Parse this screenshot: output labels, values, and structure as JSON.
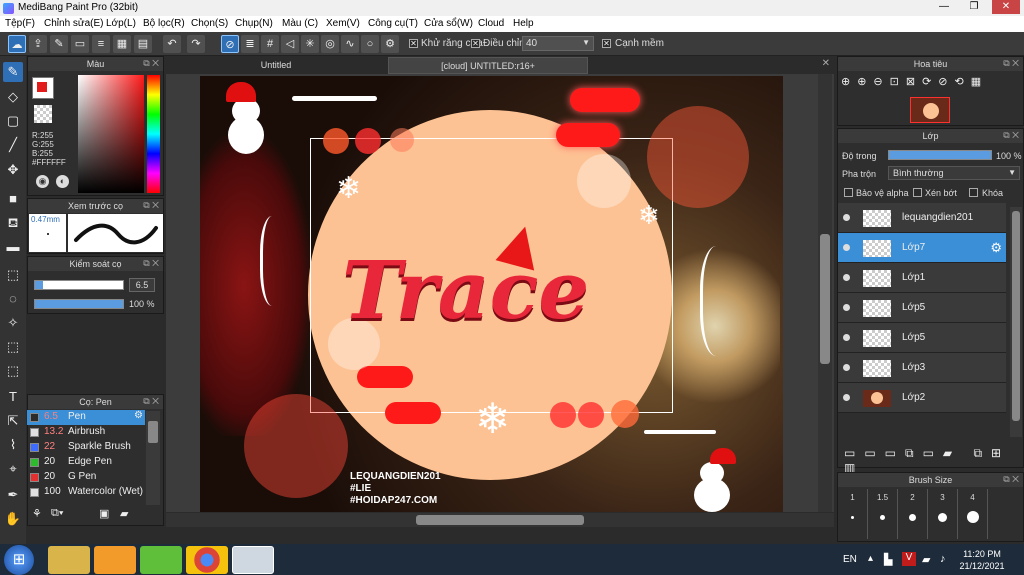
{
  "window": {
    "title": "MediBang Paint Pro (32bit)",
    "min": "—",
    "max": "❐",
    "close": "✕"
  },
  "menu": [
    "Tệp(F)",
    "Chỉnh sửa(E)",
    "Lớp(L)",
    "Bộ lọc(R)",
    "Chọn(S)",
    "Chụp(N)",
    "Màu (C)",
    "Xem(V)",
    "Công cụ(T)",
    "Cửa sổ(W)",
    "Cloud",
    "Help"
  ],
  "toolbar": {
    "antialias_label": "Khử răng cưa",
    "adjust_label": "Điều chỉnh",
    "adjust_value": "40",
    "sharpen_label": "Cạnh mềm"
  },
  "color_panel": {
    "title": "Màu",
    "r": "R:255",
    "g": "G:255",
    "b": "B:255",
    "hex": "#FFFFFF"
  },
  "preview_panel": {
    "title": "Xem trước cọ",
    "size": "0.47mm"
  },
  "control_panel": {
    "title": "Kiểm soát cọ",
    "size": "6.5",
    "opacity": "100 %"
  },
  "brush_panel": {
    "title": "Cọ: Pen",
    "items": [
      {
        "size": "6.5",
        "name": "Pen",
        "color": "#2b2b2b"
      },
      {
        "size": "13.2",
        "name": "Airbrush",
        "color": "#e0e0e0"
      },
      {
        "size": "22",
        "name": "Sparkle Brush",
        "color": "#3d6cff"
      },
      {
        "size": "20",
        "name": "Edge Pen",
        "color": "#2dba2d"
      },
      {
        "size": "20",
        "name": "G Pen",
        "color": "#e53030"
      },
      {
        "size": "100",
        "name": "Watercolor (Wet)",
        "color": "#e0e0e0"
      }
    ]
  },
  "tabs": [
    {
      "label": "Untitled"
    },
    {
      "label": "[cloud] UNTITLED:r16+"
    }
  ],
  "navigator": {
    "title": "Hoa tiêu"
  },
  "layer_panel": {
    "title": "Lớp",
    "opacity_label": "Độ trong",
    "opacity_value": "100 %",
    "blend_label": "Pha trộn",
    "blend_value": "Bình thường",
    "protect_alpha": "Bảo vệ alpha",
    "clip": "Xén bớt",
    "lock": "Khóa",
    "layers": [
      "lequangdien201",
      "Lớp7",
      "Lớp1",
      "Lớp5",
      "Lớp5",
      "Lớp3",
      "Lớp2"
    ]
  },
  "brush_size": {
    "title": "Brush Size",
    "sizes": [
      "1",
      "1.5",
      "2",
      "3",
      "4"
    ]
  },
  "art": {
    "title": "Trace",
    "credit1": "LEQUANGDIEN201",
    "credit2": "#LIE",
    "credit3": "#HOIDAP247.COM"
  },
  "taskbar": {
    "lang": "EN",
    "time": "11:20 PM",
    "date": "21/12/2021"
  }
}
